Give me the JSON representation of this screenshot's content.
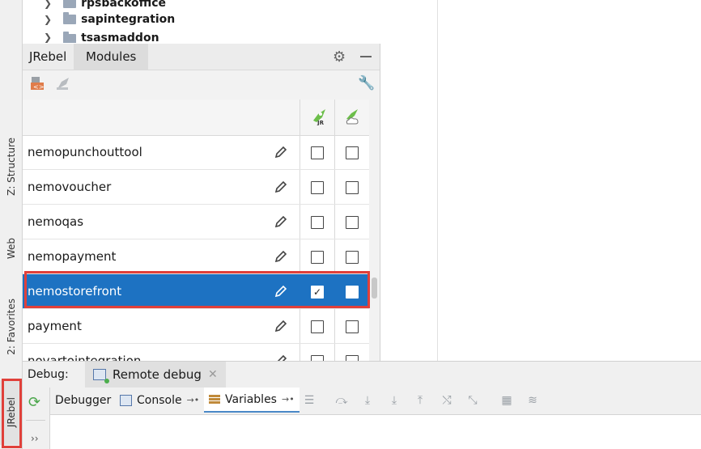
{
  "project_tree": {
    "items": [
      {
        "label": "rpsbackoffice"
      },
      {
        "label": "sapintegration"
      },
      {
        "label": "tsasmaddon"
      }
    ]
  },
  "left_toolbar": {
    "structure_label": "Z: Structure",
    "web_label": "Web",
    "favorites_label": "2: Favorites",
    "jrebel_label": "JRebel"
  },
  "jrebel_panel": {
    "tabs": [
      {
        "label": "JRebel"
      },
      {
        "label": "Modules"
      }
    ],
    "rows": [
      {
        "name": "nemopunchouttool",
        "jr": false,
        "cloud": false,
        "selected": false
      },
      {
        "name": "nemovoucher",
        "jr": false,
        "cloud": false,
        "selected": false
      },
      {
        "name": "nemoqas",
        "jr": false,
        "cloud": false,
        "selected": false
      },
      {
        "name": "nemopayment",
        "jr": false,
        "cloud": false,
        "selected": false
      },
      {
        "name": "nemostorefront",
        "jr": true,
        "cloud": false,
        "selected": true
      },
      {
        "name": "payment",
        "jr": false,
        "cloud": false,
        "selected": false
      },
      {
        "name": "novartointegration",
        "jr": false,
        "cloud": false,
        "selected": false
      }
    ]
  },
  "debug": {
    "label": "Debug:",
    "session_tab": "Remote debug",
    "tabs": [
      {
        "label": "Debugger"
      },
      {
        "label": "Console"
      },
      {
        "label": "Variables"
      }
    ],
    "more_label": "››"
  },
  "colors": {
    "selection": "#1d72c2",
    "highlight_box": "#e0403a"
  }
}
